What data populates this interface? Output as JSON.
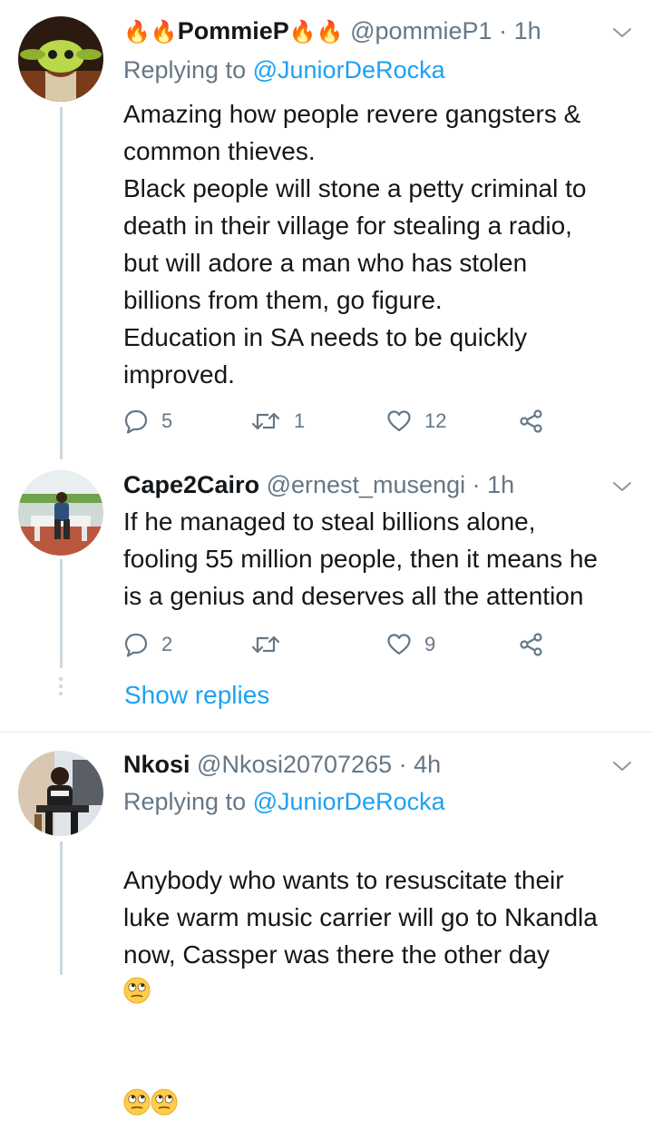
{
  "tweets": [
    {
      "name": "PommieP",
      "name_prefix": "🔥🔥",
      "name_suffix": "🔥🔥",
      "handle": "@pommieP1",
      "sep": "·",
      "time": "1h",
      "replying_label": "Replying to",
      "replying_to": "@JuniorDeRocka",
      "text": "Amazing how people revere gangsters &\ncommon thieves.\nBlack people will stone a petty criminal to\ndeath in their village for stealing a radio,\nbut will adore a man who has stolen\nbillions from them, go figure.\nEducation in SA needs to be quickly\nimproved.",
      "replies": "5",
      "retweets": "1",
      "likes": "12"
    },
    {
      "name": "Cape2Cairo",
      "handle": "@ernest_musengi",
      "sep": "·",
      "time": "1h",
      "text": "If he managed to steal billions alone,\nfooling 55 million people, then it means he\nis a genius and deserves all the attention",
      "replies": "2",
      "retweets": "",
      "likes": "9",
      "show_replies": "Show replies"
    },
    {
      "name": "Nkosi",
      "handle": "@Nkosi20707265",
      "sep": "·",
      "time": "4h",
      "replying_label": "Replying to",
      "replying_to": "@JuniorDeRocka",
      "text": "Anybody who wants to resuscitate their\nluke warm music carrier will go to Nkandla\nnow, Cassper was there the other day"
    }
  ],
  "icons": {
    "reply": "reply-icon",
    "retweet": "retweet-icon",
    "like": "heart-icon",
    "share": "share-icon",
    "caret": "chevron-down-icon",
    "emoji": "face-with-rolling-eyes-icon"
  },
  "colors": {
    "link": "#1da1f2",
    "secondary": "#657786",
    "text": "#14171a",
    "divider": "#e1e8ed"
  }
}
